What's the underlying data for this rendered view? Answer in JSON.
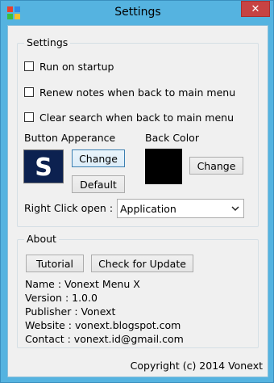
{
  "window": {
    "title": "Settings",
    "close_label": "✕",
    "footer": "Copyright (c) 2014 Vonext"
  },
  "settings": {
    "group_title": "Settings",
    "options": [
      {
        "label": "Run on startup",
        "checked": false
      },
      {
        "label": "Renew notes when back to main menu",
        "checked": false
      },
      {
        "label": "Clear search when back to main menu",
        "checked": false
      }
    ],
    "button_appearance_label": "Button Apperance",
    "back_color_label": "Back Color",
    "change_label": "Change",
    "default_label": "Default",
    "back_color_change_label": "Change",
    "back_color_value": "#000000",
    "button_preview_color": "#0c2150",
    "right_click_label": "Right Click open :",
    "right_click_value": "Application"
  },
  "about": {
    "group_title": "About",
    "tutorial_label": "Tutorial",
    "check_update_label": "Check for Update",
    "name": "Name : Vonext Menu X",
    "version": "Version : 1.0.0",
    "publisher": "Publisher : Vonext",
    "website": "Website : vonext.blogspot.com",
    "contact": "Contact : vonext.id@gmail.com"
  },
  "icons": {
    "app": "app-grid-icon",
    "close": "close-icon",
    "dropdown": "chevron-down-icon",
    "preview": "letter-s-icon"
  }
}
